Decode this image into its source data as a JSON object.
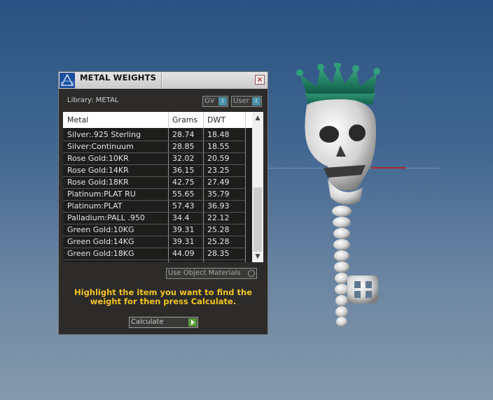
{
  "panel": {
    "title": "METAL WEIGHTS",
    "close_label": "×",
    "library_label": "Library: METAL",
    "toggle_gv": {
      "label": "GV",
      "btn": "I"
    },
    "toggle_user": {
      "label": "User",
      "btn": "I"
    },
    "table": {
      "headers": [
        "Metal",
        "Grams",
        "DWT"
      ],
      "rows": [
        [
          "Silver:.925 Sterling",
          "28.74",
          "18.48"
        ],
        [
          "Silver:Continuum",
          "28.85",
          "18.55"
        ],
        [
          "Rose Gold:10KR",
          "32.02",
          "20.59"
        ],
        [
          "Rose Gold:14KR",
          "36.15",
          "23.25"
        ],
        [
          "Rose Gold:18KR",
          "42.75",
          "27.49"
        ],
        [
          "Platinum:PLAT RU",
          "55.65",
          "35.79"
        ],
        [
          "Platinum:PLAT",
          "57.43",
          "36.93"
        ],
        [
          "Palladium:PALL .950",
          "34.4",
          "22.12"
        ],
        [
          "Green Gold:10KG",
          "39.31",
          "25.28"
        ],
        [
          "Green Gold:14KG",
          "39.31",
          "25.28"
        ],
        [
          "Green Gold:18KG",
          "44.09",
          "28.35"
        ]
      ],
      "scroll_up": "▲",
      "scroll_down": "▼"
    },
    "use_object_materials": "Use Object Materials",
    "instruction": "Highlight the item you want to find the weight for then press Calculate.",
    "calculate_label": "Calculate"
  },
  "colors": {
    "instruction": "#f2c320",
    "toggle_accent": "#4b91a8",
    "calculate_accent": "#5b9a3c",
    "crown": "#1f8a6a"
  },
  "icons": {
    "title_logo": "pyramid-logo-icon",
    "close": "close-icon",
    "calculate": "play-arrow-icon"
  }
}
